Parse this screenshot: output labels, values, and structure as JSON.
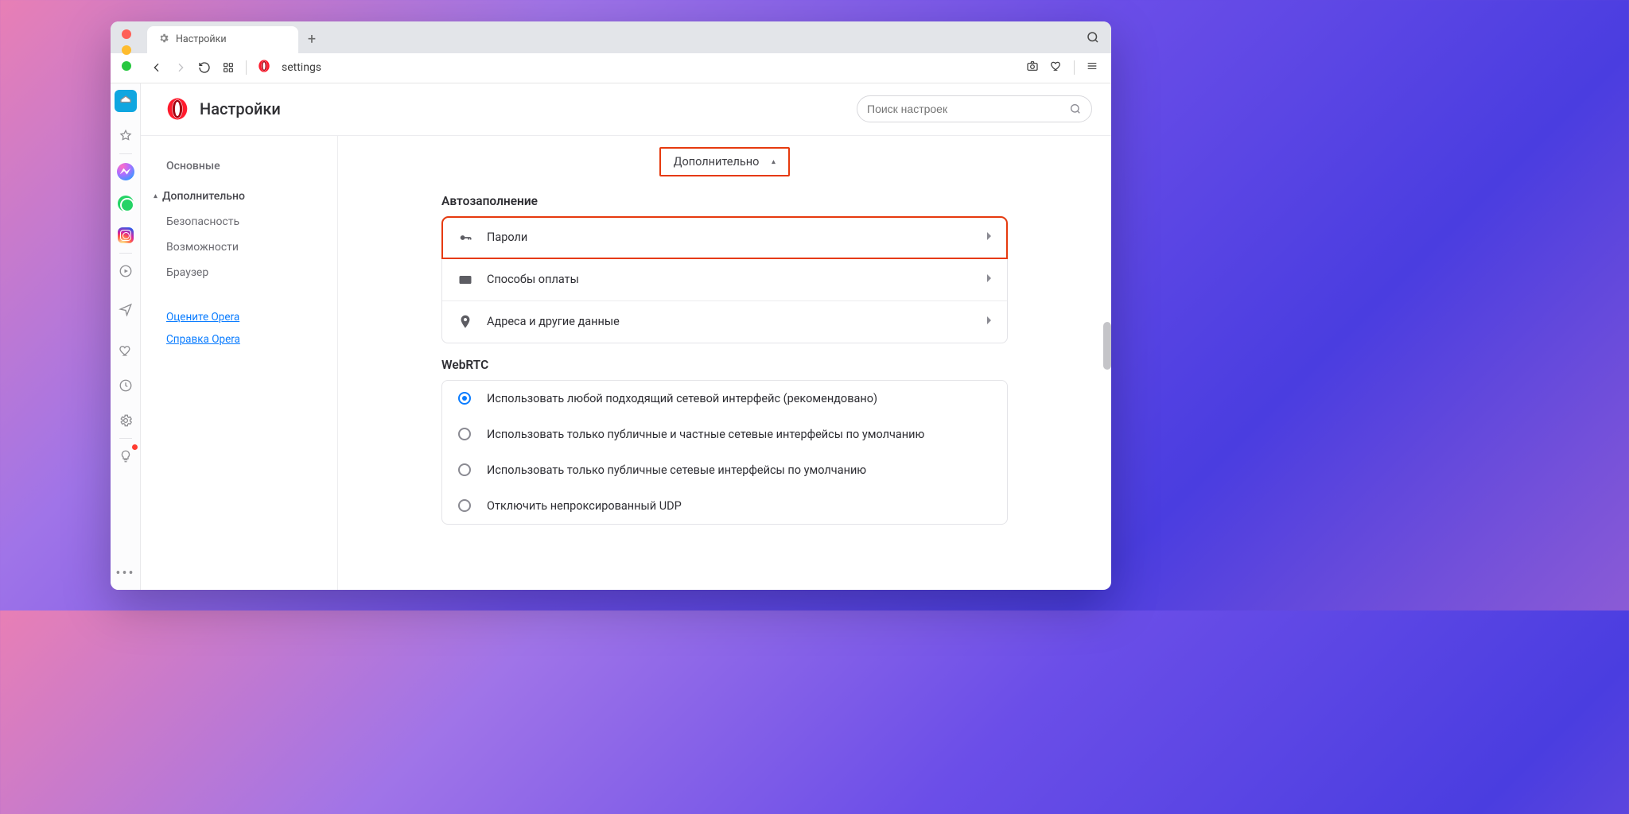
{
  "tabbar": {
    "tab_title": "Настройки",
    "new_tab_icon": "plus"
  },
  "addressbar": {
    "url": "settings"
  },
  "page_header": {
    "title": "Настройки",
    "search_placeholder": "Поиск настроек"
  },
  "sidebar": {
    "basic": "Основные",
    "advanced": "Дополнительно",
    "items": {
      "security": "Безопасность",
      "features": "Возможности",
      "browser": "Браузер"
    },
    "rate": "Оцените Opera",
    "help": "Справка Opera"
  },
  "main": {
    "advanced_toggle": "Дополнительно",
    "autofill": {
      "title": "Автозаполнение",
      "passwords": "Пароли",
      "payment": "Способы оплаты",
      "addresses": "Адреса и другие данные"
    },
    "webrtc": {
      "title": "WebRTC",
      "opt_any": "Использовать любой подходящий сетевой интерфейс (рекомендовано)",
      "opt_pubpriv": "Использовать только публичные и частные сетевые интерфейсы по умолчанию",
      "opt_pub": "Использовать только публичные сетевые интерфейсы по умолчанию",
      "opt_disable": "Отключить непроксированный UDP",
      "selected": 0
    }
  }
}
